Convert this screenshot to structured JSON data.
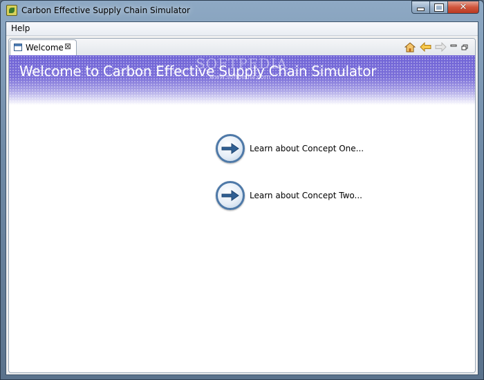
{
  "window": {
    "title": "Carbon Effective Supply Chain Simulator"
  },
  "menubar": {
    "items": [
      {
        "label": "Help"
      }
    ]
  },
  "tabs": [
    {
      "label": "Welcome",
      "close_glyph": "⊠"
    }
  ],
  "toolbar": {
    "icons": [
      "home-icon",
      "back-arrow-icon",
      "forward-arrow-icon",
      "minimize-view-icon",
      "maximize-view-icon"
    ]
  },
  "banner": {
    "title": "Welcome to Carbon Effective Supply Chain Simulator",
    "watermark": "SOFTPEDIA",
    "watermark_sub": "www.softpedia.com"
  },
  "links": [
    {
      "label": "Learn about Concept One..."
    },
    {
      "label": "Learn about Concept Two..."
    }
  ],
  "colors": {
    "banner": "#7b6fd9",
    "arrow_ring": "#4e79a8"
  }
}
